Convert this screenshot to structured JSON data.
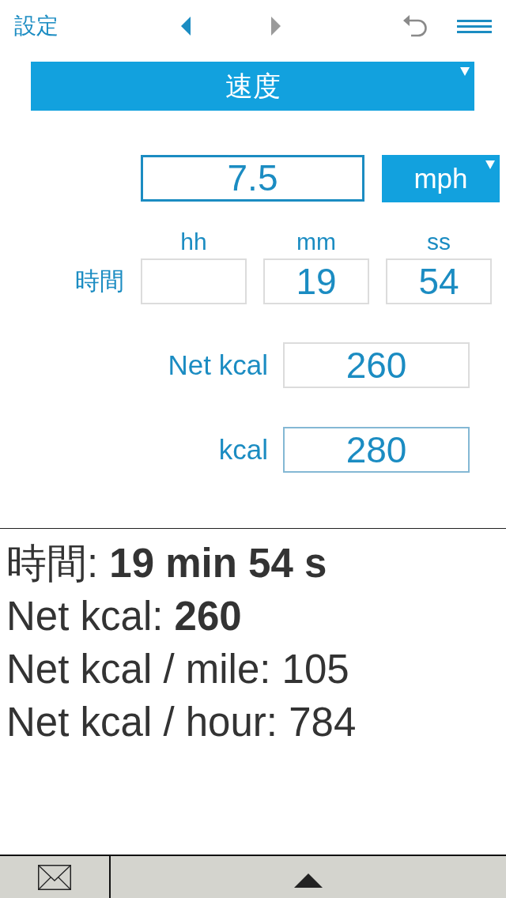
{
  "header": {
    "title": "設定",
    "nav_buttons": [
      {
        "kind": "previous",
        "disabled": false
      },
      {
        "kind": "next",
        "disabled": true
      }
    ]
  },
  "mode_select": {
    "label": "速度"
  },
  "speed": {
    "value": "7.5",
    "unit": "mph"
  },
  "time": {
    "label": "時間",
    "fields": [
      {
        "heading": "hh"
      },
      {
        "heading": "mm",
        "value": "19"
      },
      {
        "heading": "ss",
        "value": "54"
      }
    ]
  },
  "energy": [
    {
      "label": "Net kcal",
      "value": "260",
      "highlighted": false
    },
    {
      "label": "kcal",
      "value": "280",
      "highlighted": true
    }
  ],
  "summary": [
    "時間: **19 min 54 s**",
    "Net kcal: **260**",
    "Net kcal / mile: 105",
    "Net kcal / hour: 784"
  ]
}
